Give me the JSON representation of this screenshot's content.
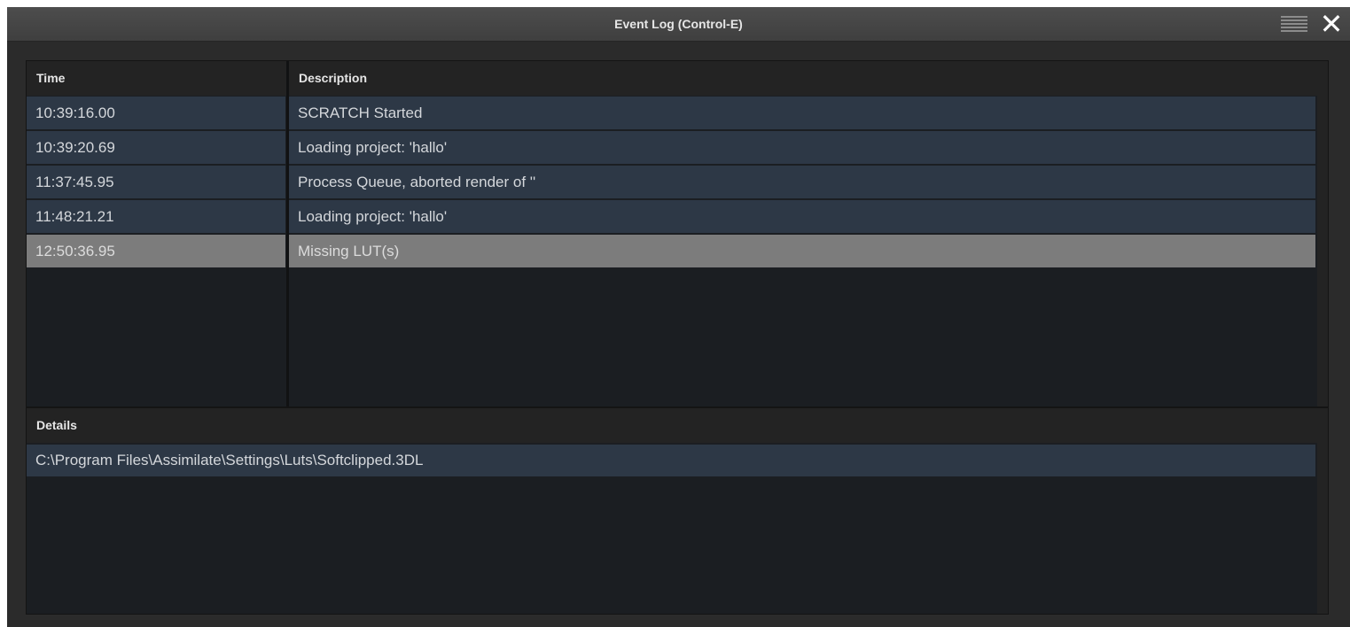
{
  "window": {
    "title": "Event Log (Control-E)",
    "menu_icon": "hamburger-menu-icon",
    "close_icon": "close-icon",
    "close_glyph": "✕"
  },
  "events": {
    "columns": {
      "time": "Time",
      "description": "Description"
    },
    "rows": [
      {
        "time": "10:39:16.00",
        "description": "SCRATCH Started",
        "selected": false
      },
      {
        "time": "10:39:20.69",
        "description": "Loading project: 'hallo'",
        "selected": false
      },
      {
        "time": "11:37:45.95",
        "description": "Process Queue, aborted render of ''",
        "selected": false
      },
      {
        "time": "11:48:21.21",
        "description": "Loading project: 'hallo'",
        "selected": false
      },
      {
        "time": "12:50:36.95",
        "description": "Missing LUT(s)",
        "selected": true
      }
    ]
  },
  "details": {
    "header": "Details",
    "text": "C:\\Program Files\\Assimilate\\Settings\\Luts\\Softclipped.3DL"
  },
  "colors": {
    "row_background": "#2d3846",
    "selected_row_background": "#7c7c7c",
    "panel_background": "#1b1e22",
    "titlebar_background": "#454545"
  }
}
